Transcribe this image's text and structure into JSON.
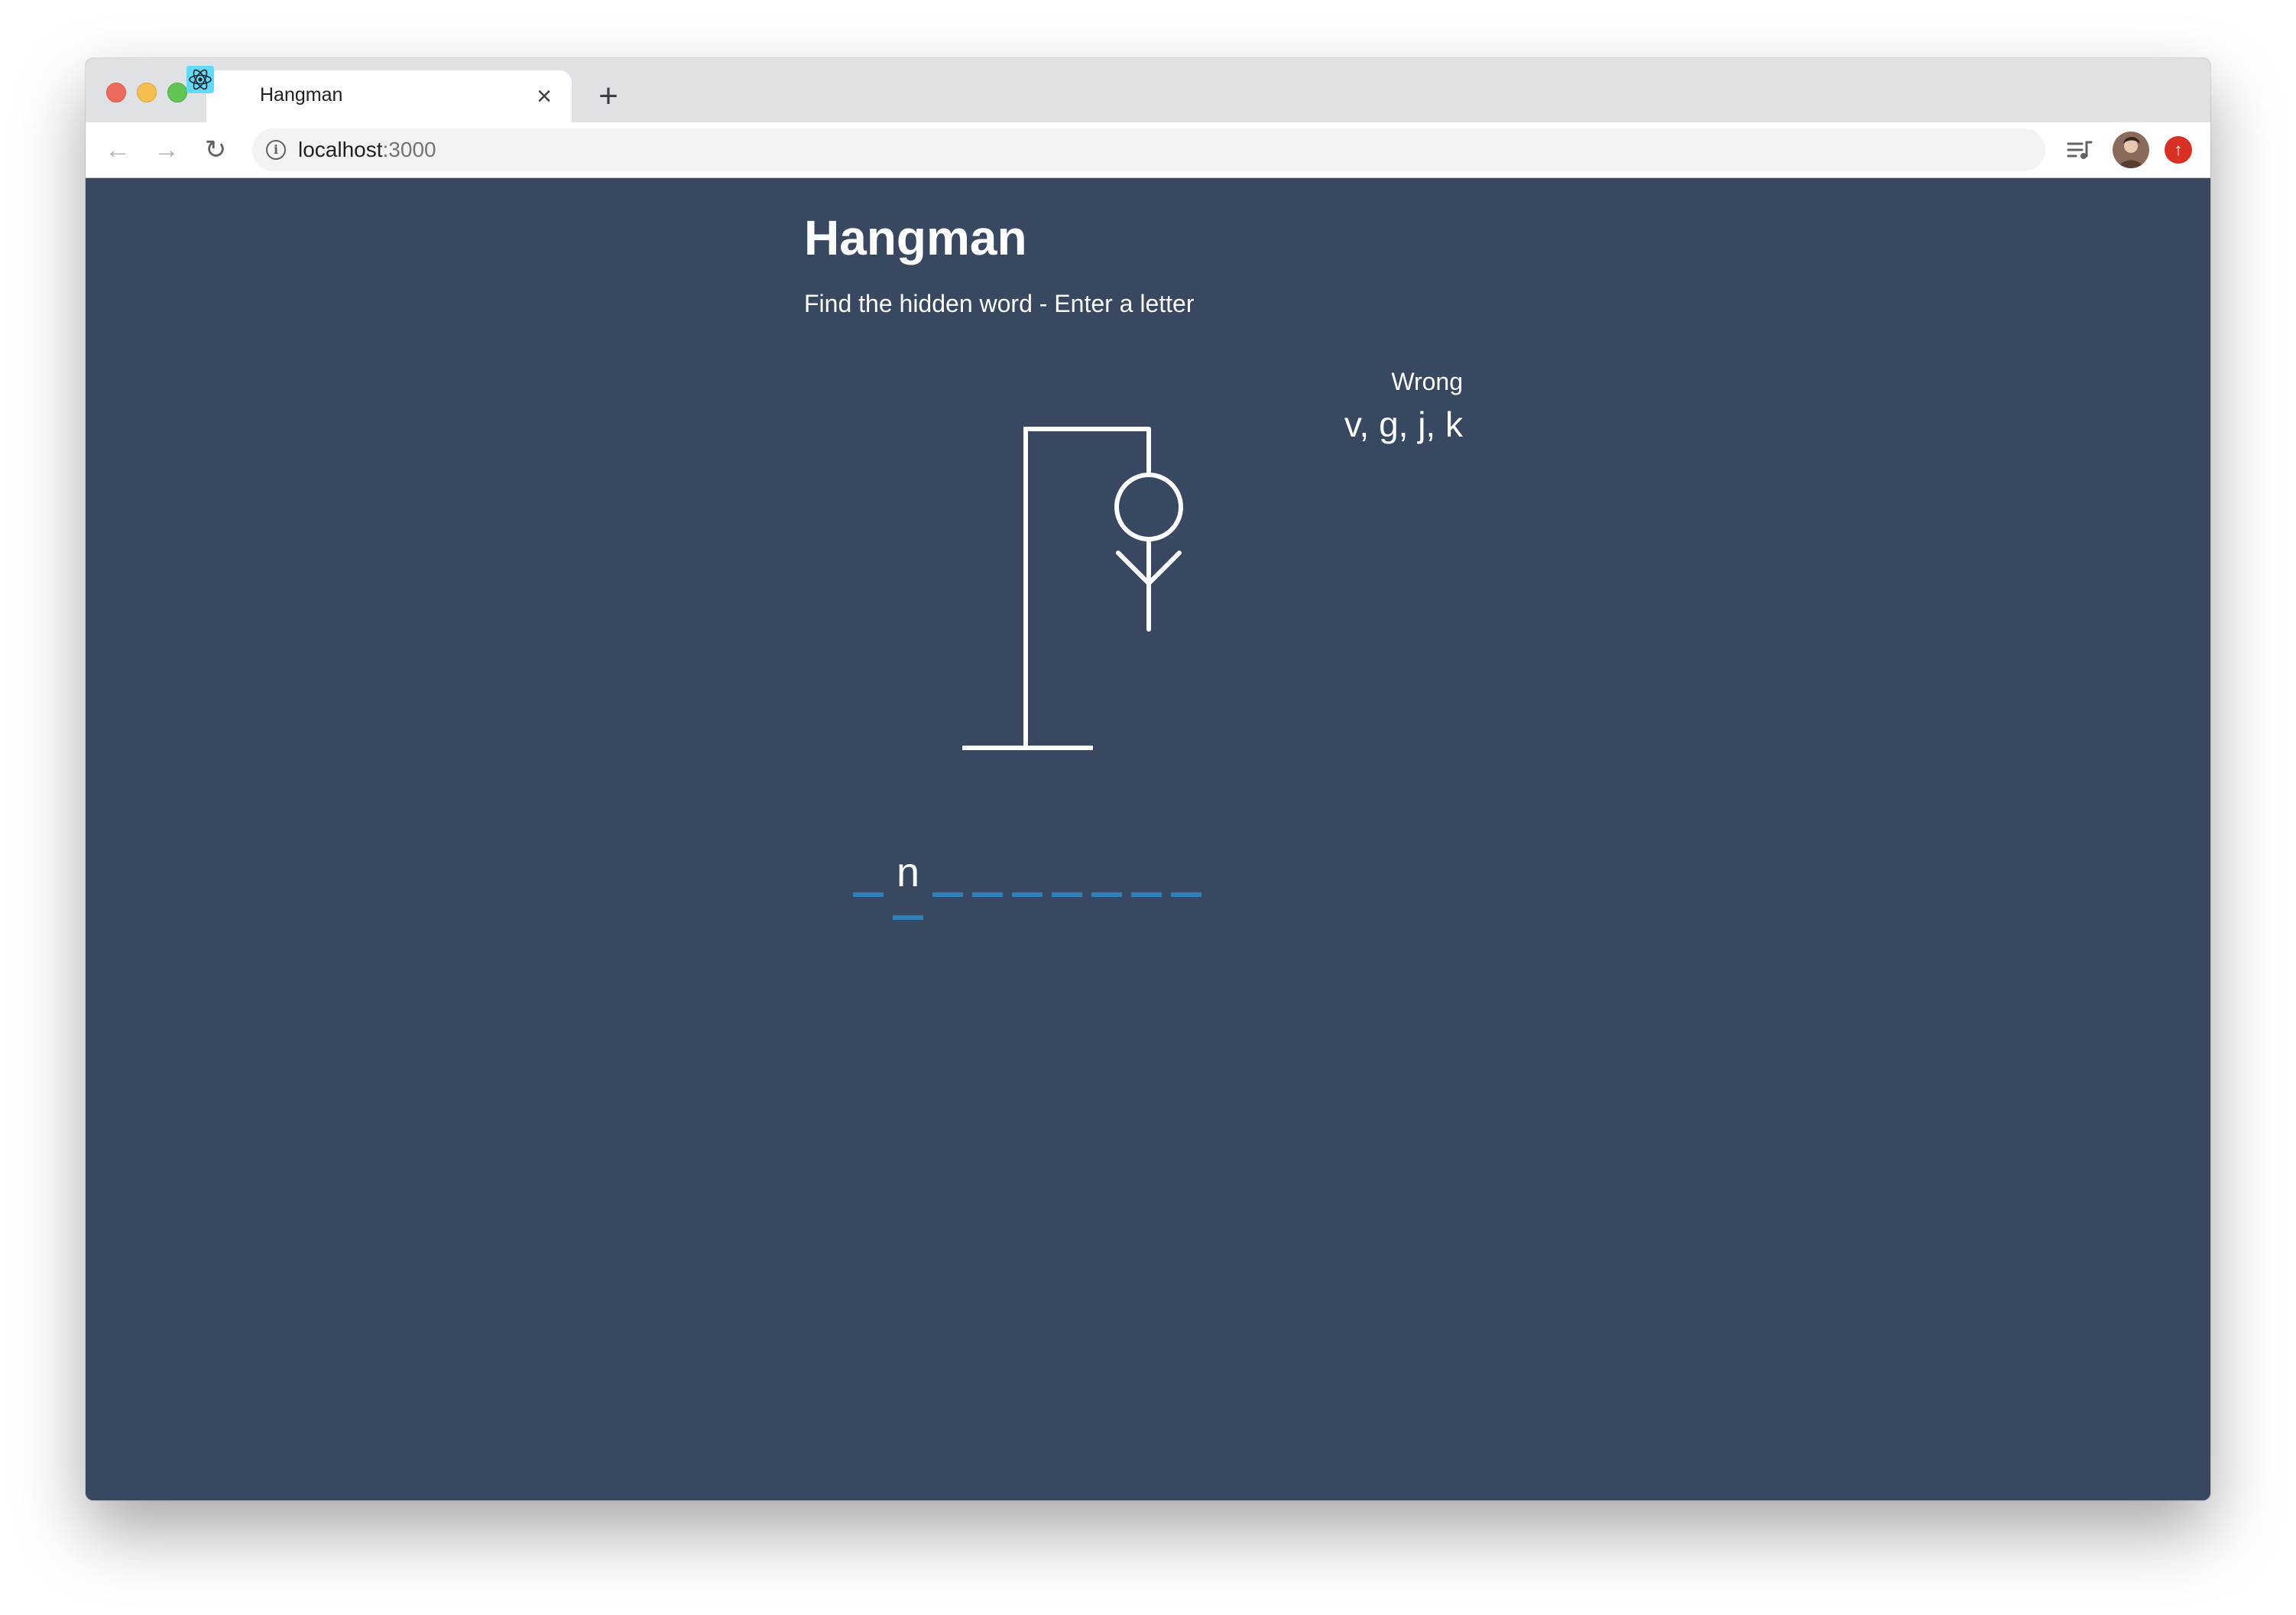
{
  "browser": {
    "tab": {
      "title": "Hangman",
      "close_glyph": "×",
      "favicon": "react-logo-icon"
    },
    "new_tab_glyph": "+",
    "address": {
      "host": "localhost",
      "port": ":3000"
    },
    "nav": {
      "back": "←",
      "forward": "→",
      "reload": "↻"
    },
    "star_glyph": "☆",
    "update_glyph": "↑"
  },
  "game": {
    "title": "Hangman",
    "subtitle": "Find the hidden word - Enter a letter",
    "wrong_label": "Wrong",
    "wrong_letters": "v, g, j, k",
    "wrong_count": 4,
    "word_slots": [
      "",
      "n",
      "",
      "",
      "",
      "",
      "",
      "",
      ""
    ]
  },
  "colors": {
    "background": "#374860",
    "text": "#ffffff",
    "underline": "#2d80b9",
    "tabstrip": "#dfe1e5"
  }
}
